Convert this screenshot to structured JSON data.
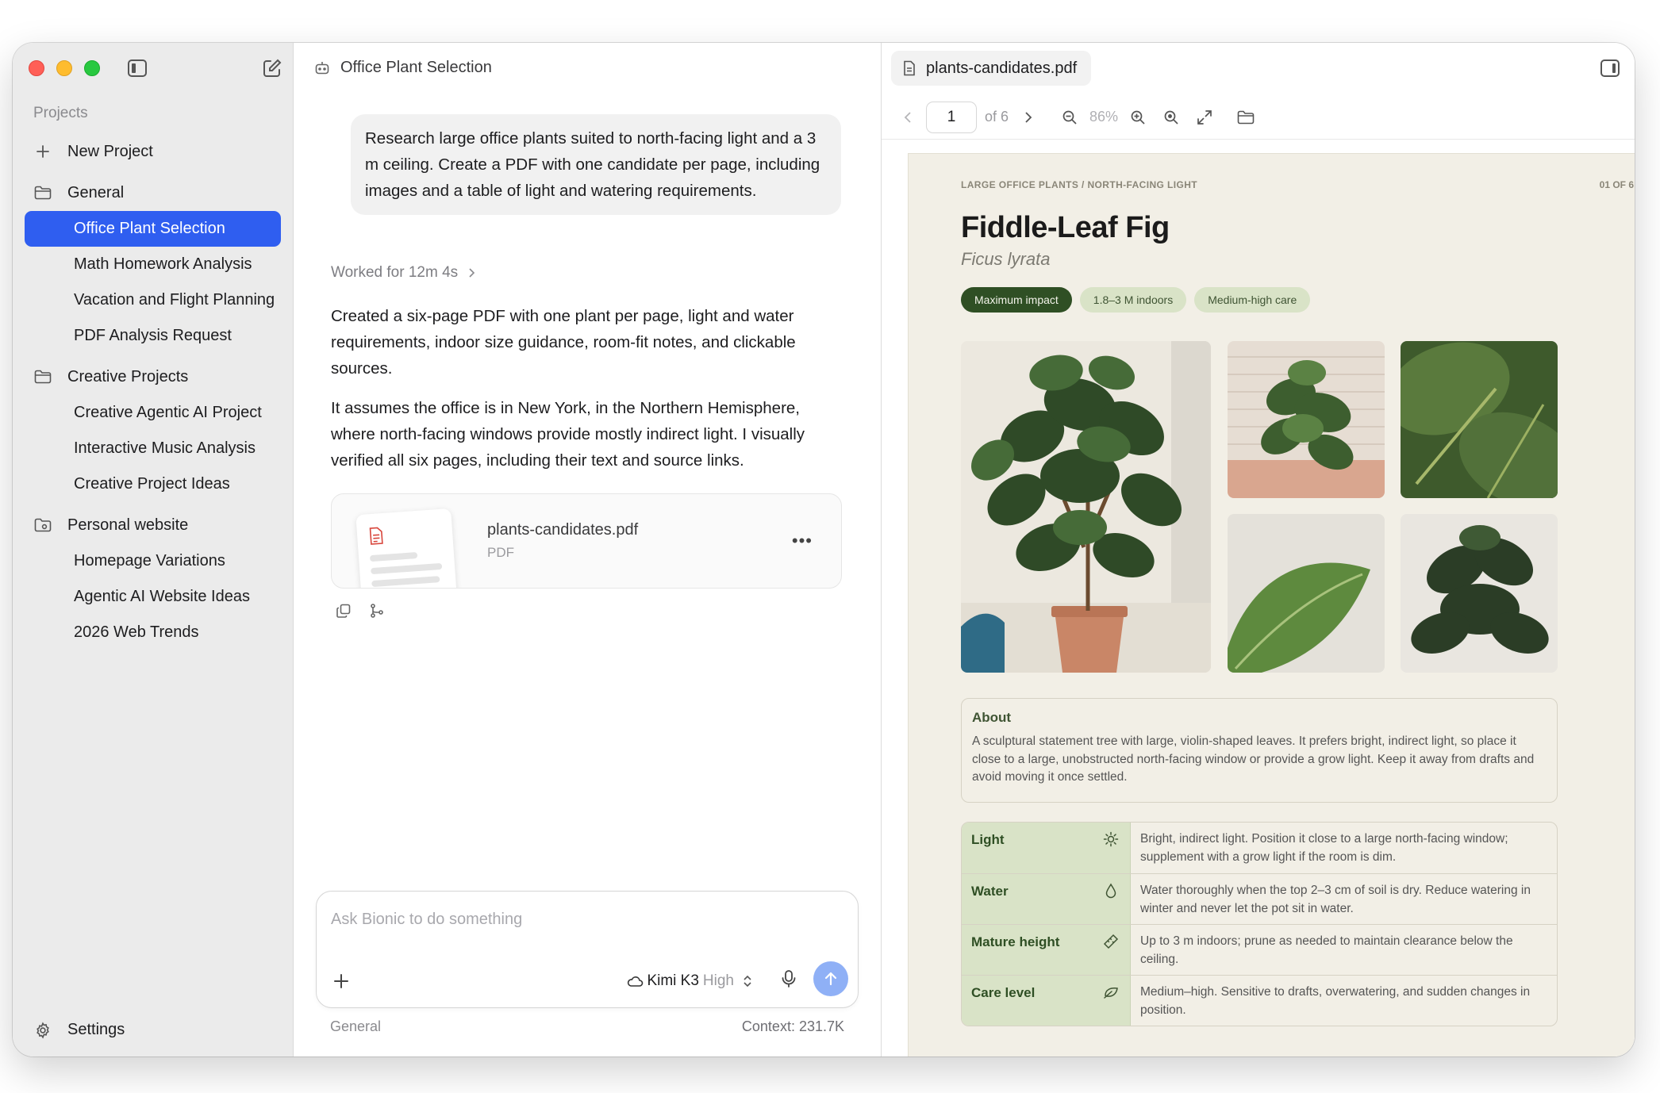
{
  "sidebar": {
    "section_title": "Projects",
    "new_project": "New Project",
    "groups": [
      {
        "label": "General",
        "items": [
          "Office Plant Selection",
          "Math Homework Analysis",
          "Vacation and Flight Planning",
          "PDF Analysis Request"
        ]
      },
      {
        "label": "Creative Projects",
        "items": [
          "Creative Agentic AI Project",
          "Interactive Music Analysis",
          "Creative Project Ideas"
        ]
      },
      {
        "label": "Personal website",
        "items": [
          "Homepage Variations",
          "Agentic AI Website Ideas",
          "2026 Web Trends"
        ]
      }
    ],
    "active_item": "Office Plant Selection",
    "settings": "Settings"
  },
  "chat": {
    "title": "Office Plant Selection",
    "user_message": "Research large office plants suited to north-facing light and a 3 m ceiling. Create a PDF with one candidate per page, including images and a table of light and watering requirements.",
    "worked_for": "Worked for 12m 4s",
    "reply_paragraphs": [
      "Created a six-page PDF with one plant per page, light and water requirements, indoor size guidance, room-fit notes, and clickable sources.",
      "It assumes the office is in New York, in the Northern Hemisphere, where north-facing windows provide mostly indirect light. I visually verified all six pages, including their text and source links."
    ],
    "attachment": {
      "name": "plants-candidates.pdf",
      "type": "PDF",
      "more": "•••"
    },
    "composer": {
      "placeholder": "Ask Bionic to do something",
      "model": "Kimi K3",
      "level": "High"
    },
    "footer_left": "General",
    "footer_right": "Context: 231.7K"
  },
  "viewer": {
    "tab": "plants-candidates.pdf",
    "page_current": "1",
    "page_total": "of 6",
    "zoom": "86%",
    "pdf": {
      "eyebrow": "LARGE OFFICE PLANTS / NORTH-FACING LIGHT",
      "page_number": "01 OF 6",
      "title": "Fiddle-Leaf Fig",
      "latin": "Ficus lyrata",
      "tags": [
        "Maximum impact",
        "1.8–3 M indoors",
        "Medium-high care"
      ],
      "about_heading": "About",
      "about_text": "A sculptural statement tree with large, violin-shaped leaves. It prefers bright, indirect light, so place it close to a large, unobstructed north-facing window or provide a grow light. Keep it away from drafts and avoid moving it once settled.",
      "care": [
        {
          "label": "Light",
          "icon": "sun-icon",
          "value": "Bright, indirect light. Position it close to a large north-facing window; supplement with a grow light if the room is dim."
        },
        {
          "label": "Water",
          "icon": "water-drop-icon",
          "value": "Water thoroughly when the top 2–3 cm of soil is dry. Reduce watering in winter and never let the pot sit in water."
        },
        {
          "label": "Mature height",
          "icon": "ruler-icon",
          "value": "Up to 3 m indoors; prune as needed to maintain clearance below the ceiling."
        },
        {
          "label": "Care level",
          "icon": "leaf-icon",
          "value": "Medium–high. Sensitive to drafts, overwatering, and sudden changes in position."
        }
      ]
    }
  },
  "colors": {
    "accent": "#2f5ef0",
    "sidebar_bg": "#ebebeb",
    "pdf_bg": "#f2efe6",
    "pdf_green_dark": "#2f4f24",
    "pdf_green_light": "#d9e3c7",
    "send_button": "#8fb0f6"
  }
}
